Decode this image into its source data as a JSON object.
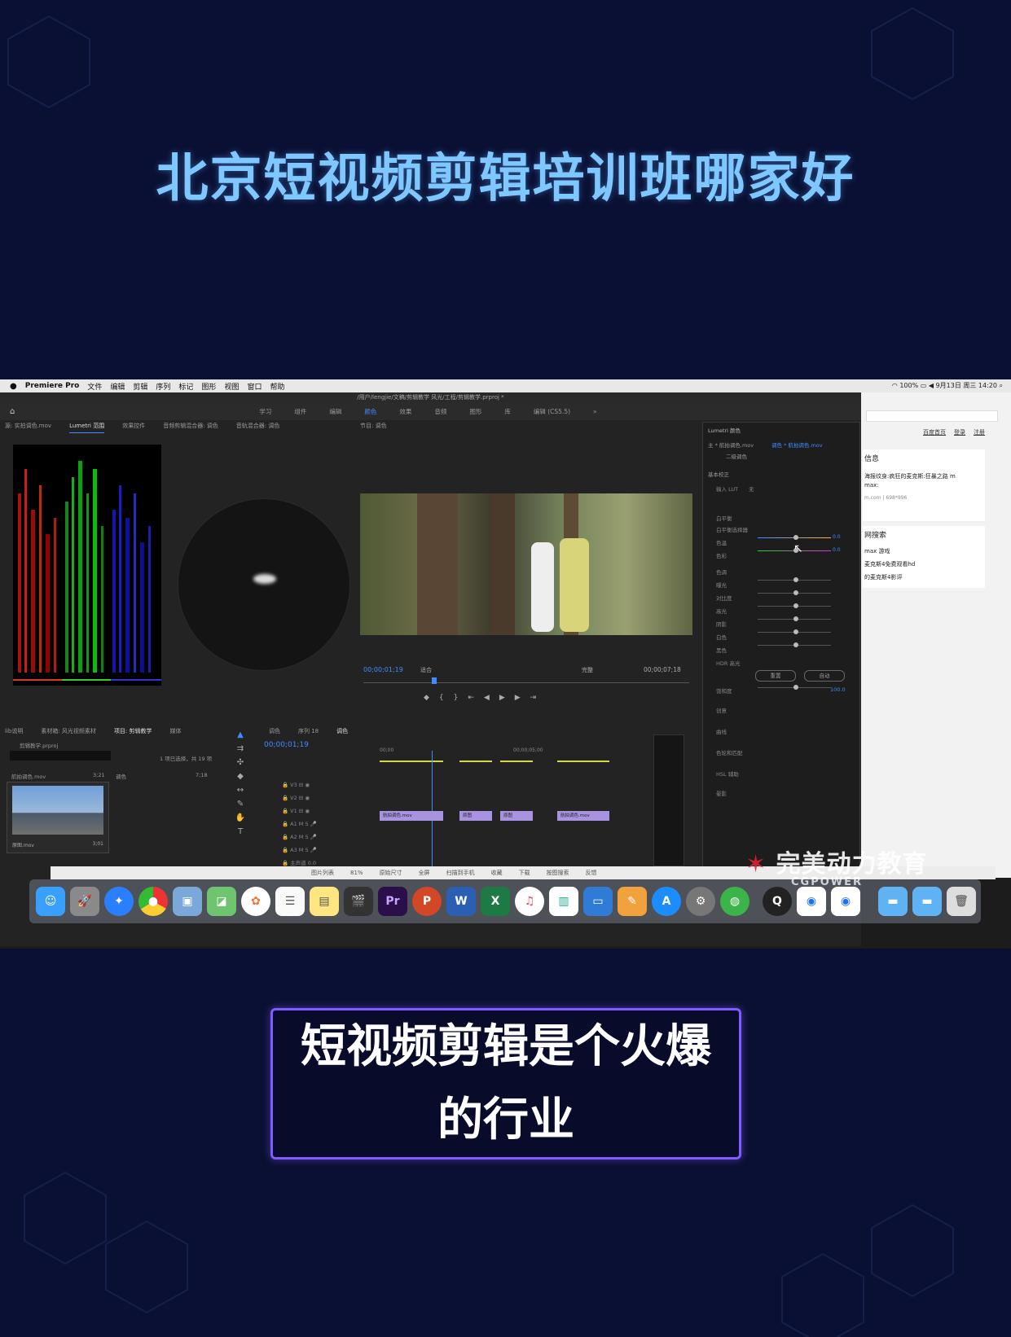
{
  "headline": "北京短视频剪辑培训班哪家好",
  "caption": "短视频剪辑是个火爆的行业",
  "menubar": {
    "app": "Premiere Pro",
    "items": [
      "文件",
      "编辑",
      "剪辑",
      "序列",
      "标记",
      "图形",
      "视图",
      "窗口",
      "帮助"
    ],
    "clock": "9月13日 周三 14:20",
    "battery": "100%"
  },
  "premiere": {
    "window_title": "/用户/lengjie/文稿/剪辑教学 风光/工程/剪辑教学.prproj *",
    "workspaces": [
      "学习",
      "组件",
      "编辑",
      "颜色",
      "效果",
      "音频",
      "图形",
      "库",
      "编辑 (CS5.5)"
    ],
    "active_workspace": "颜色",
    "top_panel_tabs": [
      "源: 实拍调色.mov",
      "Lumetri 范围",
      "效果控件",
      "音频剪辑混合器: 调色",
      "音轨混合器: 调色"
    ],
    "program_tab": "节目: 调色",
    "program_timecode": "00;00;01;19",
    "program_fit": "适合",
    "program_quality": "完整",
    "program_duration": "00;00;07;18",
    "project_tabs": [
      "lib说明",
      "素材箱: 风光视频素材",
      "项目: 剪辑教学",
      "媒体"
    ],
    "project_file": "剪辑教学.prproj",
    "project_selection": "1 项已选择，共 19 项",
    "project_items": [
      {
        "name": "航拍调色.mov",
        "duration": "3;21"
      },
      {
        "name": "调色",
        "duration": "7;18"
      }
    ],
    "thumb_name": "原图.mov",
    "thumb_duration": "3;01",
    "timeline_tabs": [
      "调色",
      "序列 18",
      "调色"
    ],
    "timeline_timecode": "00;00;01;19",
    "ruler": [
      "00;00",
      "00;00;05;00"
    ],
    "clips": [
      "航拍调色.mov",
      "原图",
      "原图",
      "航拍调色.mov"
    ],
    "lumetri": {
      "title": "Lumetri 颜色",
      "source": "主 * 航拍调色.mov",
      "target": "调色 * 航拍调色.mov",
      "preset": "二级调色",
      "sections": [
        "基本校正",
        "创意",
        "曲线",
        "色轮和匹配",
        "HSL 辅助",
        "晕影"
      ],
      "input_lut_label": "输入 LUT",
      "input_lut_value": "无",
      "wb_label": "白平衡",
      "wb_picker": "白平衡选择器",
      "temp_label": "色温",
      "tint_label": "色彩",
      "tone_label": "色调",
      "tone_rows": [
        "曝光",
        "对比度",
        "高光",
        "阴影",
        "白色",
        "黑色"
      ],
      "hdr_label": "HDR 高光",
      "sat_label": "饱和度",
      "btn_reset": "重置",
      "btn_auto": "自动",
      "value_zero": "0.0",
      "sat_value": "100.0"
    }
  },
  "browser": {
    "links": [
      "百度首页",
      "登录",
      "注册"
    ],
    "section_info": "信息",
    "result_text": "海报纹身:疯狂的麦克斯:狂暴之路 m",
    "result_sub": "max:",
    "result_meta": "m.com | 698*996",
    "section_search": "网搜索",
    "search_items": [
      "max 游戏",
      "麦克斯4免费观看hd",
      "的麦克斯4影评"
    ]
  },
  "footer_items": [
    "图片列表",
    "81%",
    "原始尺寸",
    "全屏",
    "扫描到手机",
    "收藏",
    "下载",
    "按图搜索",
    "反馈"
  ],
  "watermark": {
    "cn": "完美动力教育",
    "en": "CGPOWER"
  },
  "dock": [
    "Finder",
    "Launchpad",
    "Safari",
    "Chrome",
    "Preview",
    "Maps",
    "Photos",
    "TextEdit",
    "Notes",
    "Final Cut Pro",
    "Pr",
    "P",
    "W",
    "X",
    "Music",
    "Numbers",
    "Keynote",
    "Pages",
    "App Store",
    "System Preferences",
    "WeChat",
    "QuickTime",
    "Media",
    "Media",
    "Folder",
    "Folder",
    "Trash"
  ]
}
